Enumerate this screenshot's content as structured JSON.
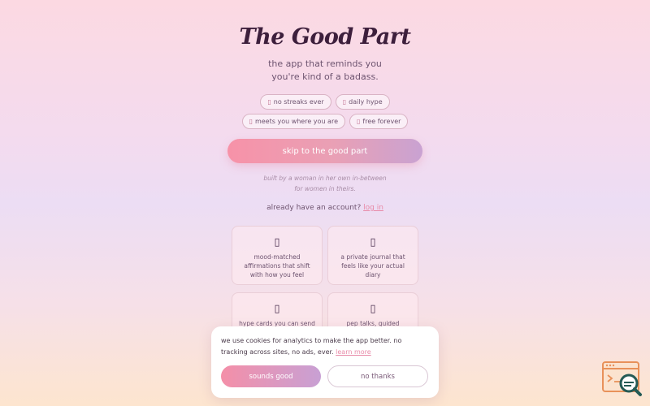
{
  "header": {
    "title": "The Good Part",
    "subtitle_line1": "the app that reminds you",
    "subtitle_line2": "you're kind of a badass."
  },
  "pills": [
    {
      "icon": "no-streaks-icon",
      "glyph": "▯",
      "label": "no streaks ever"
    },
    {
      "icon": "daily-hype-icon",
      "glyph": "▯",
      "label": "daily hype"
    },
    {
      "icon": "meets-you-icon",
      "glyph": "▯",
      "label": "meets you where you are"
    },
    {
      "icon": "free-forever-icon",
      "glyph": "▯",
      "label": "free forever"
    }
  ],
  "cta": {
    "label": "skip to the good part"
  },
  "tagline": {
    "line1": "built by a woman in her own in-between",
    "line2": "for women in theirs."
  },
  "account": {
    "prompt": "already have an account?",
    "login_label": "log in"
  },
  "features": [
    {
      "icon": "affirmation-icon",
      "glyph": "▯",
      "text": "mood-matched affirmations that shift with how you feel"
    },
    {
      "icon": "journal-icon",
      "glyph": "▯",
      "text": "a private journal that feels like your actual diary"
    },
    {
      "icon": "hype-card-icon",
      "glyph": "▯",
      "text": "hype cards you can send"
    },
    {
      "icon": "pep-talk-icon",
      "glyph": "▯",
      "text": "pep talks, guided"
    }
  ],
  "cookie_banner": {
    "text": "we use cookies for analytics to make the app better. no tracking across sites, no ads, ever.",
    "learn_more_label": "learn more",
    "accept_label": "sounds good",
    "decline_label": "no thanks"
  },
  "colors": {
    "accent_pink": "#f792a8",
    "accent_lavender": "#c9a2d2",
    "title_color": "#3d1f3c",
    "link_color": "#e88aa8"
  }
}
